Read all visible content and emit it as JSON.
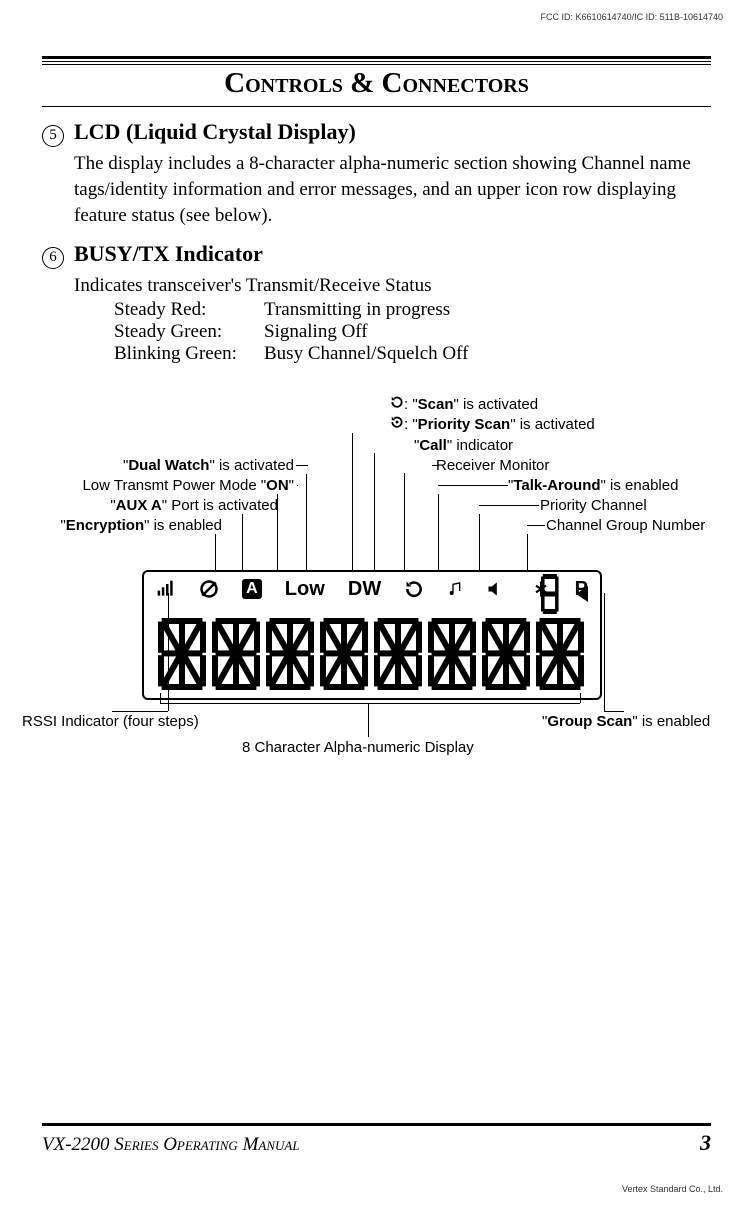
{
  "fcc_id": "FCC ID: K6610614740/IC ID: 511B-10614740",
  "page_title": "Controls & Connectors",
  "section5": {
    "num": "5",
    "title": "LCD (Liquid Crystal Display)",
    "body": "The display includes a 8-character alpha-numeric section showing Channel name tags/identity information and error messages, and an upper icon row displaying feature status (see below)."
  },
  "section6": {
    "num": "6",
    "title": "BUSY/TX Indicator",
    "intro": "Indicates transceiver's Transmit/Receive Status",
    "rows": [
      {
        "label": "Steady Red:",
        "desc": "Transmitting in progress"
      },
      {
        "label": "Steady Green:",
        "desc": "Signaling Off"
      },
      {
        "label": "Blinking Green:",
        "desc": "Busy Channel/Squelch Off"
      }
    ]
  },
  "labels": {
    "scan_pre": ": \"",
    "scan": "Scan",
    "scan_post": "\" is activated",
    "pscan_pre": ": \"",
    "pscan": "Priority Scan",
    "pscan_post": "\" is activated",
    "call_pre": "\"",
    "call": "Call",
    "call_post": "\" indicator",
    "dw_pre": "\"",
    "dw": "Dual Watch",
    "dw_post": "\" is activated",
    "low_pre": "Low Transmt Power Mode \"",
    "low": "ON",
    "low_post": "\"",
    "auxa_pre": "\"",
    "auxa": "AUX A",
    "auxa_post": "\" Port is activated",
    "enc_pre": "\"",
    "enc": "Encryption",
    "enc_post": "\" is enabled",
    "recvmon": "Receiver Monitor",
    "talk_pre": "\"",
    "talk": "Talk-Around",
    "talk_post": "\" is enabled",
    "prich": "Priority Channel",
    "chgrp": "Channel Group Number",
    "rssi": "RSSI Indicator (four steps)",
    "alphanum": "8 Character Alpha-numeric Display",
    "gscan_pre": "\"",
    "gscan": "Group Scan",
    "gscan_post": "\" is enabled"
  },
  "icons": {
    "a": "A",
    "low": "Low",
    "dw": "DW",
    "p": "P"
  },
  "footer": {
    "model": "VX-2200",
    "manual": " Series Operating Manual",
    "page": "3"
  },
  "copyright": "Vertex Standard Co., Ltd."
}
